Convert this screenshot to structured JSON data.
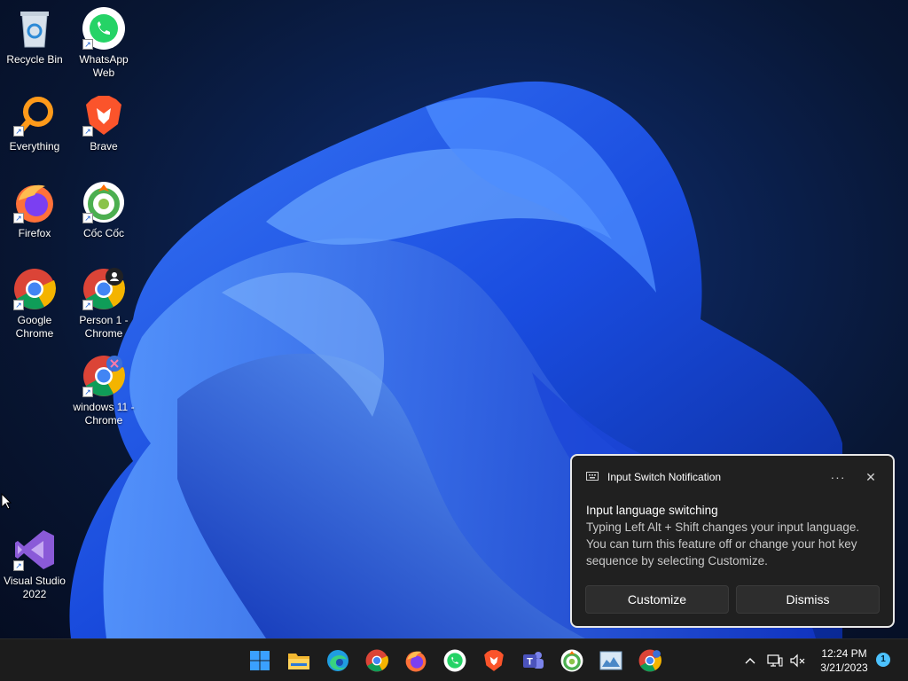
{
  "desktop": {
    "icons": [
      {
        "label": "Recycle Bin",
        "icon": "recycle-bin-icon"
      },
      {
        "label": "WhatsApp Web",
        "icon": "whatsapp-icon"
      },
      {
        "label": "Everything",
        "icon": "everything-search-icon"
      },
      {
        "label": "Brave",
        "icon": "brave-icon"
      },
      {
        "label": "Firefox",
        "icon": "firefox-icon"
      },
      {
        "label": "Cốc Cốc",
        "icon": "coccoc-icon"
      },
      {
        "label": "Google Chrome",
        "icon": "chrome-icon"
      },
      {
        "label": "Person 1 - Chrome",
        "icon": "chrome-profile-icon"
      },
      {
        "label": "windows 11 - Chrome",
        "icon": "chrome-profile-icon"
      },
      {
        "label": "Visual Studio 2022",
        "icon": "visual-studio-icon"
      }
    ]
  },
  "notification": {
    "app_title": "Input Switch Notification",
    "more_label": "···",
    "close_label": "✕",
    "heading": "Input language switching",
    "body": "Typing Left Alt + Shift changes your input language. You can turn this feature off or change your hot key sequence by selecting Customize.",
    "customize_label": "Customize",
    "dismiss_label": "Dismiss"
  },
  "taskbar": {
    "apps": [
      "start-icon",
      "file-explorer-icon",
      "edge-icon",
      "chrome-icon",
      "firefox-icon",
      "whatsapp-icon",
      "brave-icon",
      "teams-icon",
      "coccoc-icon",
      "photos-icon",
      "chrome-profile-icon"
    ],
    "tray": {
      "chevron": "^",
      "time": "12:24 PM",
      "date": "3/21/2023",
      "notification_count": "1"
    }
  },
  "colors": {
    "accent": "#4cc2ff",
    "taskbar_bg": "#1c1c1c",
    "toast_bg": "#202020"
  }
}
